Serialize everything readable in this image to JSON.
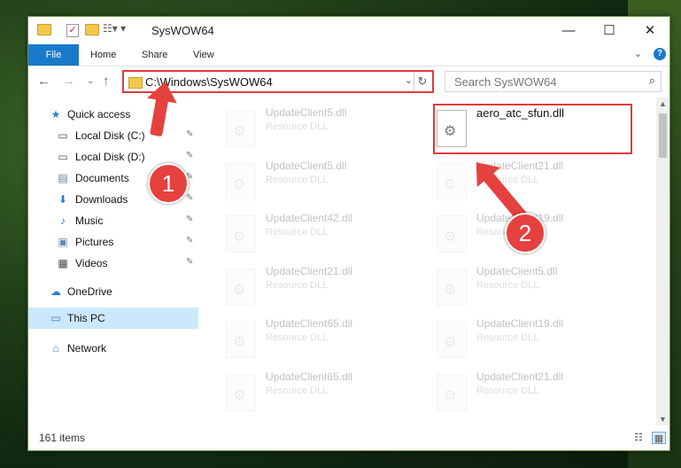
{
  "window": {
    "title": "SysWOW64",
    "minimize": "—",
    "maximize": "☐",
    "close": "✕"
  },
  "ribbon": {
    "tabs": [
      "File",
      "Home",
      "Share",
      "View"
    ],
    "expand": "⌄",
    "help": "?"
  },
  "address": {
    "path": "C:\\Windows\\SysWOW64",
    "search_placeholder": "Search SysWOW64"
  },
  "sidebar": {
    "items": [
      {
        "label": "Quick access",
        "icon": "★",
        "pinned": false
      },
      {
        "label": "Local Disk (C:)",
        "icon": "▭",
        "pinned": true
      },
      {
        "label": "Local Disk (D:)",
        "icon": "▭",
        "pinned": true
      },
      {
        "label": "Documents",
        "icon": "▤",
        "pinned": true
      },
      {
        "label": "Downloads",
        "icon": "⬇",
        "pinned": true
      },
      {
        "label": "Music",
        "icon": "♪",
        "pinned": true
      },
      {
        "label": "Pictures",
        "icon": "▣",
        "pinned": true
      },
      {
        "label": "Videos",
        "icon": "▦",
        "pinned": true
      },
      {
        "label": "OneDrive",
        "icon": "☁",
        "pinned": false
      },
      {
        "label": "This PC",
        "icon": "▭",
        "pinned": false,
        "selected": true
      },
      {
        "label": "Network",
        "icon": "⌂",
        "pinned": false
      }
    ],
    "pin_glyph": "📌"
  },
  "files": {
    "left": [
      {
        "name": "UpdateClient5.dll",
        "type": "Resource DLL"
      },
      {
        "name": "UpdateClient5.dll",
        "type": "Resource DLL"
      },
      {
        "name": "UpdateClient42.dll",
        "type": "Resource DLL"
      },
      {
        "name": "UpdateClient21.dll",
        "type": "Resource DLL"
      },
      {
        "name": "UpdateClient65.dll",
        "type": "Resource DLL"
      },
      {
        "name": "UpdateClient65.dll",
        "type": "Resource DLL"
      }
    ],
    "right": [
      {
        "name": "aero_atc_sfun.dll",
        "type": "",
        "highlighted": true
      },
      {
        "name": "UpdateClient21.dll",
        "type": "Resource DLL"
      },
      {
        "name": "UpdateClient19.dll",
        "type": "Resource DLL"
      },
      {
        "name": "UpdateClient5.dll",
        "type": "Resource DLL"
      },
      {
        "name": "UpdateClient19.dll",
        "type": "Resource DLL"
      },
      {
        "name": "UpdateClient21.dll",
        "type": "Resource DLL"
      }
    ]
  },
  "status": {
    "count": "161 items"
  },
  "annotations": {
    "step1": "1",
    "step2": "2"
  },
  "colors": {
    "accent": "#1979ca",
    "highlight_red": "#e23a3a",
    "selected_bg": "#cce8ff"
  }
}
